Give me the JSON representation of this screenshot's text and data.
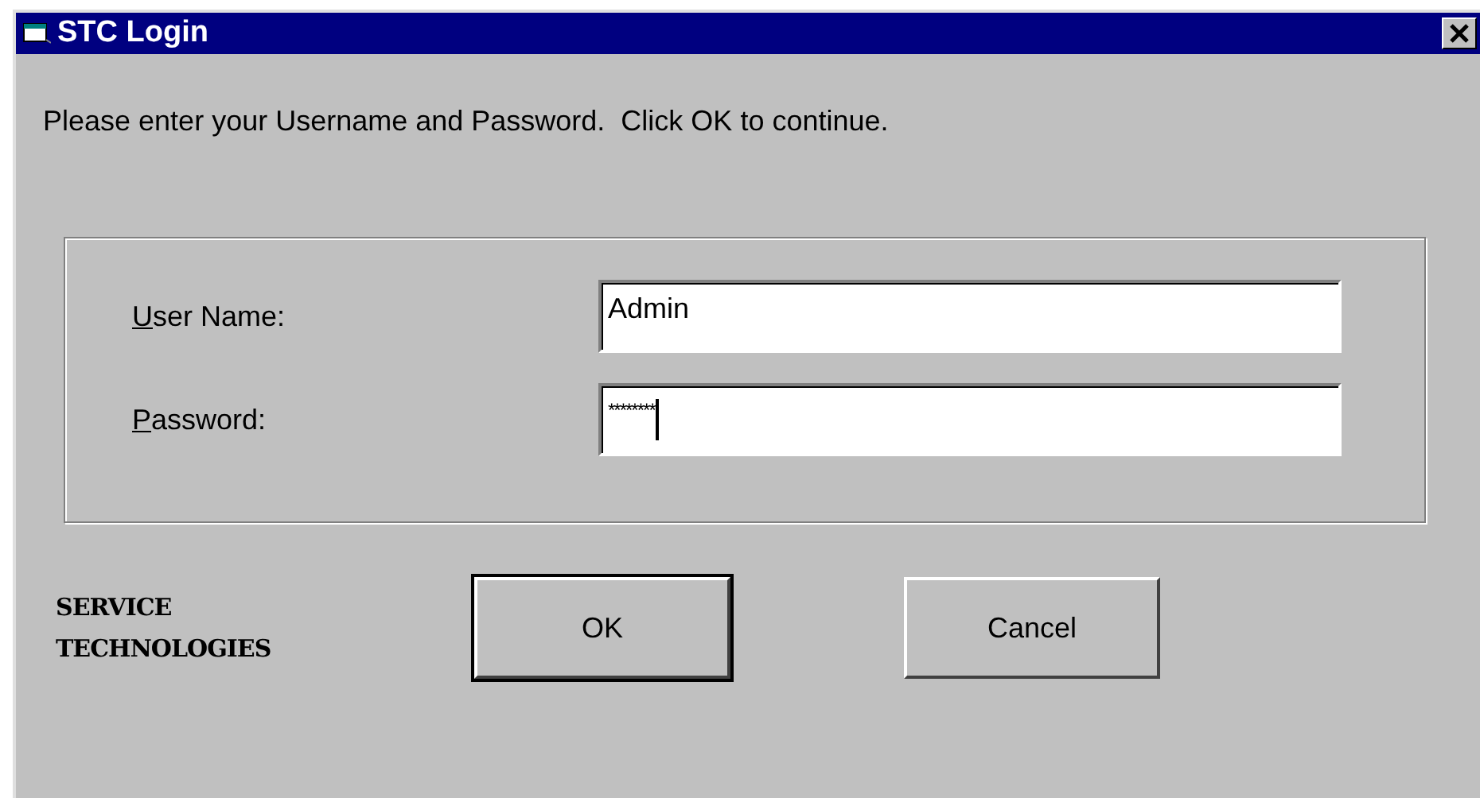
{
  "window": {
    "title": "STC Login"
  },
  "instruction": "Please enter your Username and Password.  Click OK to continue.",
  "fields": [
    {
      "label": "User Name:",
      "value": "Admin",
      "masked": false,
      "focused": false
    },
    {
      "label": "Password:",
      "value": "********",
      "masked": true,
      "focused": true
    }
  ],
  "logo": [
    "SERVICE",
    "TECHNOLOGIES"
  ],
  "buttons": [
    {
      "label": "OK",
      "default": true
    },
    {
      "label": "Cancel",
      "default": false
    }
  ]
}
